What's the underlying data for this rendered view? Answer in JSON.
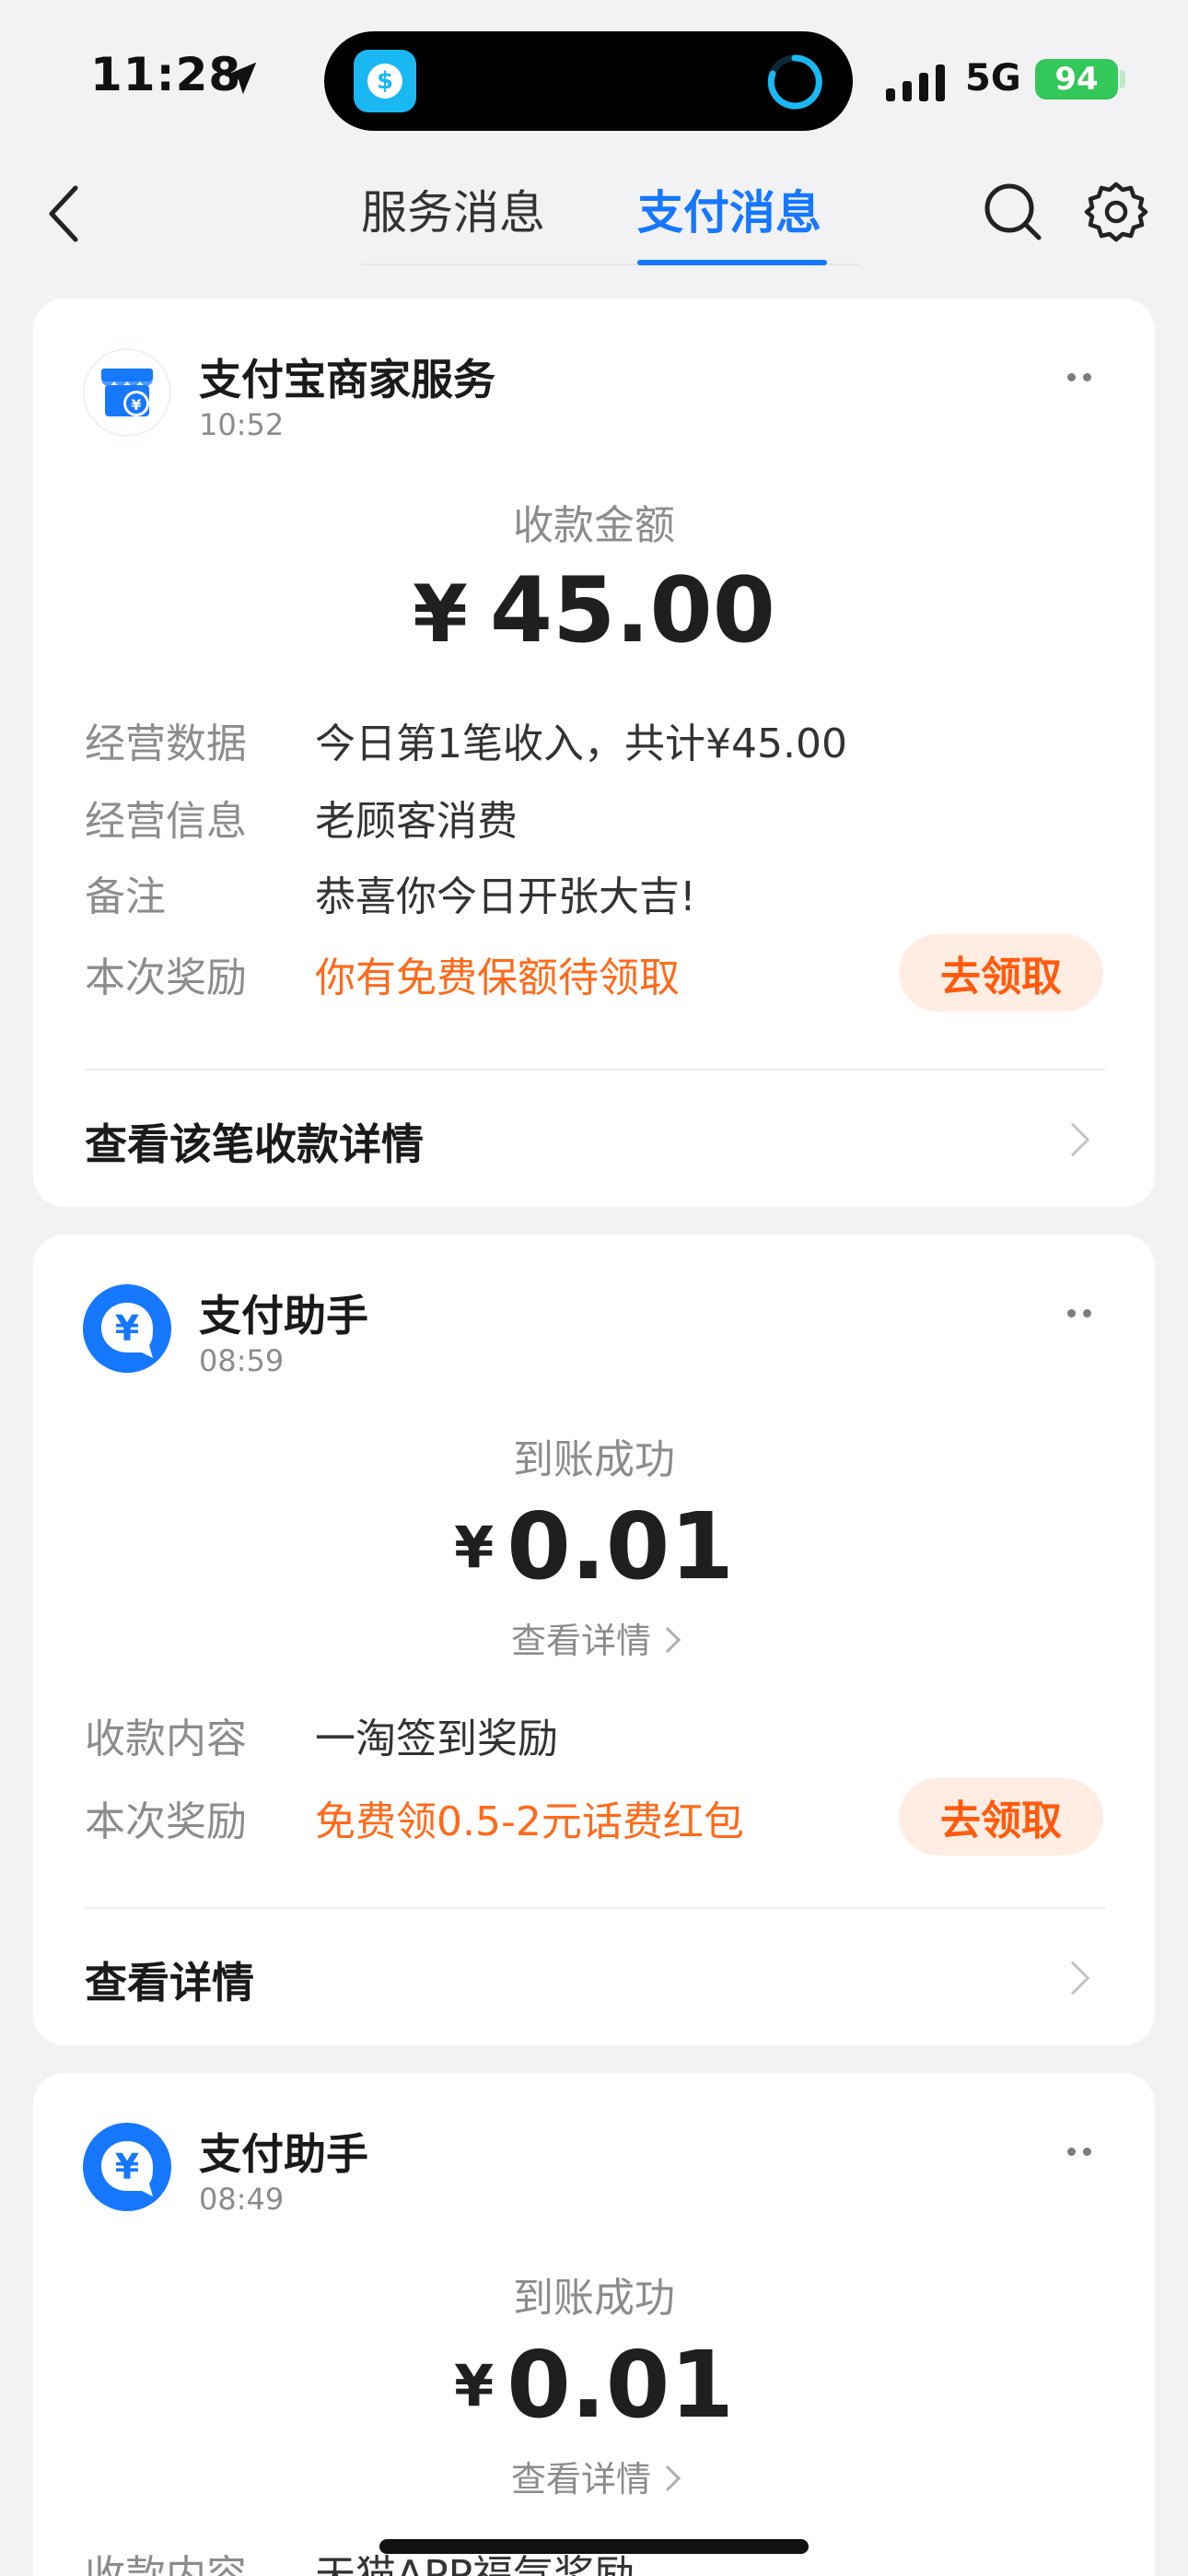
{
  "status_bar": {
    "time": "11:28",
    "network": "5G",
    "battery": "94"
  },
  "nav": {
    "tabs": [
      {
        "label": "服务消息"
      },
      {
        "label": "支付消息"
      }
    ],
    "active_tab": "支付消息"
  },
  "cards": [
    {
      "sender": "支付宝商家服务",
      "time": "10:52",
      "amount_title": "收款金额",
      "currency": "¥",
      "amount": "45.00",
      "rows": [
        {
          "label": "经营数据",
          "value": "今日第1笔收入，共计¥45.00"
        },
        {
          "label": "经营信息",
          "value": "老顾客消费"
        },
        {
          "label": "备注",
          "value": "恭喜你今日开张大吉!"
        },
        {
          "label": "本次奖励",
          "value": "你有免费保额待领取",
          "action": "去领取"
        }
      ],
      "footer": "查看该笔收款详情"
    },
    {
      "sender": "支付助手",
      "time": "08:59",
      "amount_title": "到账成功",
      "currency": "¥",
      "amount": "0.01",
      "detail_link": "查看详情",
      "rows": [
        {
          "label": "收款内容",
          "value": "一淘签到奖励"
        },
        {
          "label": "本次奖励",
          "value": "免费领0.5-2元话费红包",
          "action": "去领取"
        }
      ],
      "footer": "查看详情"
    },
    {
      "sender": "支付助手",
      "time": "08:49",
      "amount_title": "到账成功",
      "currency": "¥",
      "amount": "0.01",
      "detail_link": "查看详情",
      "rows": [
        {
          "label": "收款内容",
          "value": "天猫APP福气奖励"
        }
      ]
    }
  ],
  "colors": {
    "accent": "#1677ff",
    "reward": "#ff6a1a",
    "claim_bg": "#ffede3",
    "battery": "#34c759"
  }
}
